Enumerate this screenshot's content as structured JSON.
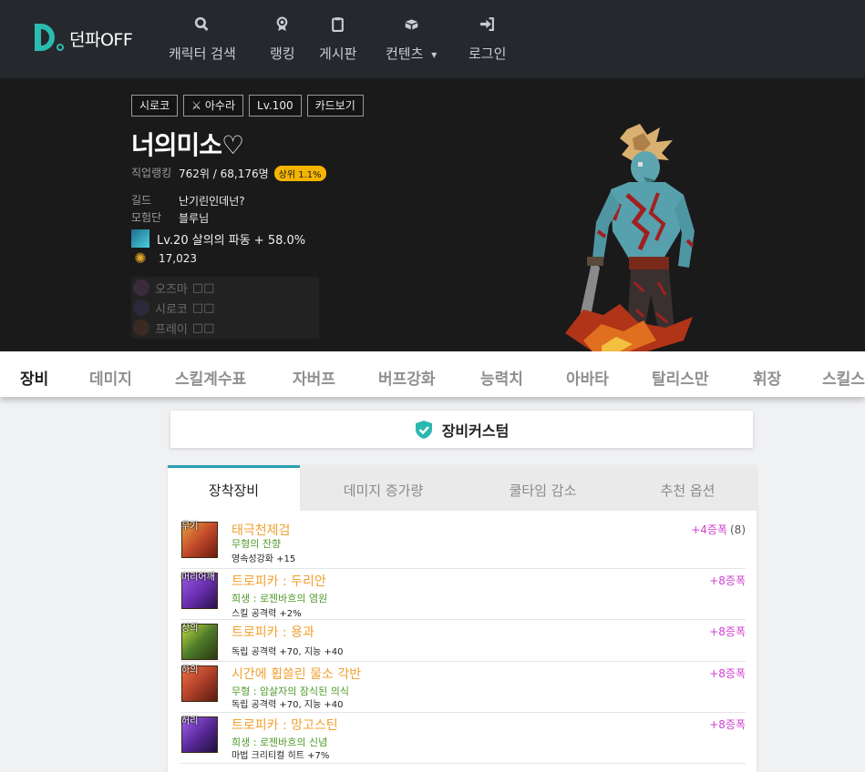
{
  "navbar": {
    "logo_text": "던파OFF",
    "items": [
      {
        "label": "캐릭터 검색",
        "icon": "search-icon"
      },
      {
        "label": "랭킹",
        "icon": "medal-icon"
      },
      {
        "label": "게시판",
        "icon": "clipboard-icon"
      },
      {
        "label": "컨텐츠",
        "icon": "box-icon",
        "caret": "▾"
      },
      {
        "label": "로그인",
        "icon": "sign-in-icon"
      }
    ]
  },
  "profile": {
    "tags": [
      "시로코",
      "아수라",
      "Lv.100",
      "카드보기"
    ],
    "name": "너의미소♡",
    "job_rank_label": "직업랭킹",
    "job_rank_value": "762위 / 68,176명",
    "job_rank_badge": "상위 1.1%",
    "guild_label": "길드",
    "guild_value": "난기린인데넌?",
    "adventure_label": "모험단",
    "adventure_value": "블루님",
    "skill_text": "Lv.20 살의의 파동 + 58.0%",
    "fame_value": "17,023",
    "raids": [
      {
        "label": "오즈마",
        "marks": "□□"
      },
      {
        "label": "시로코",
        "marks": "□□"
      },
      {
        "label": "프레이",
        "marks": "□□"
      }
    ]
  },
  "tabs": [
    "장비",
    "데미지",
    "스킬계수표",
    "자버프",
    "버프강화",
    "능력치",
    "아바타",
    "탈리스만",
    "휘장",
    "스킬스"
  ],
  "custom_banner": "장비커스텀",
  "equip_tabs": [
    "장착장비",
    "데미지 증가량",
    "쿨타임 감소",
    "추천 옵션"
  ],
  "equipment": [
    {
      "slot": "무기",
      "name": "태극천제검",
      "sub": "무형의 잔향",
      "stats": [
        "영속성강화 +15"
      ],
      "amp": "+4증폭",
      "count": "(8)",
      "color": "#c24a2a"
    },
    {
      "slot": "머리어깨",
      "name": "트로피카 : 두리안",
      "sub": "희생 : 로젠바흐의 염원",
      "stats": [
        "스킬 공격력 +2%"
      ],
      "amp": "+8증폭",
      "count": "",
      "color": "#6a2fb0"
    },
    {
      "slot": "상의",
      "name": "트로피카 : 용과",
      "sub": "",
      "stats": [
        "독립 공격력 +70, 지능 +40"
      ],
      "amp": "+8증폭",
      "count": "",
      "color": "#4f7a2a"
    },
    {
      "slot": "하의",
      "name": "시간에 휩쓸린 물소 각반",
      "sub": "무형 : 암살자의 잠식된 의식",
      "stats": [
        "독립 공격력 +70, 지능 +40"
      ],
      "amp": "+8증폭",
      "count": "",
      "color": "#b0402a"
    },
    {
      "slot": "허리",
      "name": "트로피카 : 망고스틴",
      "sub": "희생 : 로젠바흐의 신념",
      "stats": [
        "마법 크리티컬 히트 +7%"
      ],
      "amp": "+8증폭",
      "count": "",
      "color": "#5a2a9a"
    }
  ]
}
